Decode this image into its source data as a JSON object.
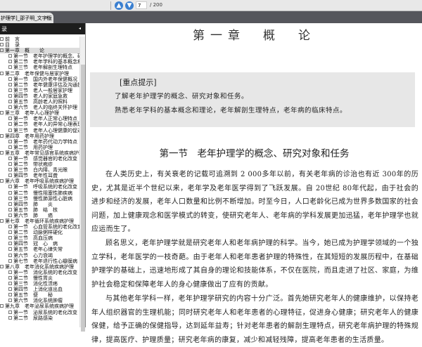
{
  "toolbar": {
    "prev_icon": "arrow-up-icon",
    "next_icon": "arrow-down-icon",
    "page": "7",
    "total": "/ 200"
  },
  "tab": {
    "title": "护理学]_邵子明_文字版",
    "close": "×"
  },
  "sidebar": {
    "title": "录",
    "collapse": "◂",
    "items": [
      {
        "l": 0,
        "t": "前　言"
      },
      {
        "l": 0,
        "t": "目　录"
      },
      {
        "l": 0,
        "t": "第一章　概　　论",
        "sel": true
      },
      {
        "l": 1,
        "t": "第一节　老年护理学的概念、研究对象和任务"
      },
      {
        "l": 1,
        "t": "第二节　老年学科的基本概念和理论"
      },
      {
        "l": 1,
        "t": "第三节　老年解剖生理特点"
      },
      {
        "l": 0,
        "t": "第二章　老年保健与居家护理"
      },
      {
        "l": 1,
        "t": "第一节　国内外老年保健概况"
      },
      {
        "l": 1,
        "t": "第二节　老年健康评估及沟通技巧"
      },
      {
        "l": 1,
        "t": "第三节　老人一般居家护理"
      },
      {
        "l": 1,
        "t": "第四节　老人的家庭急救"
      },
      {
        "l": 1,
        "t": "第五节　高龄老人的照料"
      },
      {
        "l": 1,
        "t": "第六节　老人的临终关怀护理"
      },
      {
        "l": 0,
        "t": "第三章　老年人心理护理"
      },
      {
        "l": 1,
        "t": "第一节　老年人正常心理特点"
      },
      {
        "l": 1,
        "t": "第二节　老年人的异常心理表现"
      },
      {
        "l": 1,
        "t": "第三节　老年人心理健康的促进"
      },
      {
        "l": 0,
        "t": "第四章　老年用药护理"
      },
      {
        "l": 1,
        "t": "第一节　老年药代动力学特点"
      },
      {
        "l": 1,
        "t": "第二节　用药护理"
      },
      {
        "l": 0,
        "t": "第五章　老年常见感官系统疾病护理"
      },
      {
        "l": 1,
        "t": "第一节　感觉器官的老化改变"
      },
      {
        "l": 1,
        "t": "第二节　带状疱疹"
      },
      {
        "l": 1,
        "t": "第三节　白内障、青光眼"
      },
      {
        "l": 1,
        "t": "第四节　老年性耳聋"
      },
      {
        "l": 0,
        "t": "第六章　老年呼吸系统疾病护理"
      },
      {
        "l": 1,
        "t": "第一节　呼吸系统的老化改变"
      },
      {
        "l": 1,
        "t": "第二节　慢性阻塞性肺疾病"
      },
      {
        "l": 1,
        "t": "第三节　慢性肺源性心脏病"
      },
      {
        "l": 1,
        "t": "第四节　肺　　炎"
      },
      {
        "l": 1,
        "t": "第五节　肺　结　核"
      },
      {
        "l": 1,
        "t": "第六节　肺　　癌"
      },
      {
        "l": 0,
        "t": "第七章　老年循环系统疾病护理"
      },
      {
        "l": 1,
        "t": "第一节　心血管系统的老化改变"
      },
      {
        "l": 1,
        "t": "第二节　动脉粥样硬化"
      },
      {
        "l": 1,
        "t": "第三节　高血压病"
      },
      {
        "l": 1,
        "t": "第四节　冠　心　病"
      },
      {
        "l": 1,
        "t": "第五节　老年心律失常"
      },
      {
        "l": 1,
        "t": "第六节　心力衰竭"
      },
      {
        "l": 1,
        "t": "第七节　老年退行性心瓣膜病"
      },
      {
        "l": 0,
        "t": "第八章　老年消化系统疾病护理"
      },
      {
        "l": 1,
        "t": "第一节　消化系统的老化改变"
      },
      {
        "l": 1,
        "t": "第二节　慢性胃炎"
      },
      {
        "l": 1,
        "t": "第三节　消化性溃疡"
      },
      {
        "l": 1,
        "t": "第四节　上消化道出血"
      },
      {
        "l": 1,
        "t": "第五节　便　　秘"
      },
      {
        "l": 1,
        "t": "第六节　消化系统肿瘤"
      },
      {
        "l": 0,
        "t": "第九章　老年泌尿系统疾病护理"
      },
      {
        "l": 1,
        "t": "第一节　泌尿系统的老化改变"
      },
      {
        "l": 1,
        "t": "第二节　尿路感染"
      }
    ]
  },
  "page": {
    "chapter": "第一章　概　论",
    "hint_title": "[重点提示]",
    "hints": [
      "了解老年护理学的概念、研究对象和任务。",
      "熟悉老年学科的基本概念和理论，老年解剖生理特点，老年病的临床特点。"
    ],
    "section": "第一节　老年护理学的概念、研究对象和任务",
    "paragraphs": [
      "在人类历史上，有关衰老的记载可追溯到 2 000多年以前，有关老年病的诊治也有近 300年的历史，尤其是近半个世纪以来，老年学及老年医学得到了飞跃发展。自 20世纪 80年代起，由于社会的进步和经济的发展，老年人口数量和比例不断增加。时至今日，人口老龄化已成为世界多数国家的社会问题，加上健康观念和医学模式的转变，使研究老年人、老年病的学科发展更加迅猛，老年护理学也就应运而生了。",
      "顾名思义，老年护理学就是研究老年人和老年病护理的科学。当今，她已成为护理学领域的一个独立学科，老年医学的一枝奇葩。由于老年人和老年患者护理的特殊性，在其短短的发展历程中，在基础护理学的基础上，迅速地形成了其自身的理论和技能体系，不仅在医院，而且走进了社区、家庭，为维护社会稳定和保障老年人的身心健康做出了应有的贡献。",
      "与其他老年学科一样，老年护理学研究的内容十分广泛。首先她研究老年人的健康维护，以保持老年人组织器官的生理机能；同时研究老年人和老年患者的心理特征，促进身心健康；研究老年人的健康保健，给予正确的保健指导，达到延年益寿；针对老年患者的解剖生理特点，研究老年病护理的特殊规律，提高医疗、护理质量；研究老年病的康复，减少和减轻残障，提高老年患者的生活质量。"
    ]
  }
}
